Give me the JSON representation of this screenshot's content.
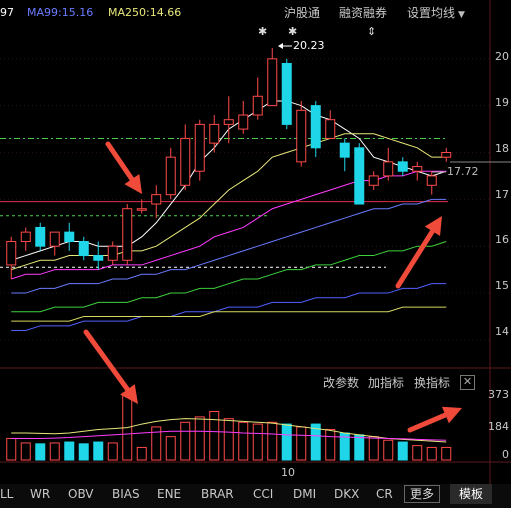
{
  "top_bar": {
    "ma_items": [
      {
        "label": "97",
        "color": "#ffffff"
      },
      {
        "label": "MA99:15.16",
        "color": "#6a7bff"
      },
      {
        "label": "MA250:14.66",
        "color": "#e8e87a"
      }
    ],
    "menu": [
      {
        "label": "沪股通"
      },
      {
        "label": "融资融券"
      },
      {
        "label": "设置均线",
        "dropdown": true
      }
    ]
  },
  "price_axis": {
    "ticks": [
      "20",
      "19",
      "18",
      "17",
      "16",
      "15",
      "14"
    ]
  },
  "annotations": {
    "high_price": "20.23",
    "last_price": "17.72",
    "marker_star": "✱",
    "marker_arrow": "⇕"
  },
  "indicator_menu": {
    "items": [
      "改参数",
      "加指标",
      "换指标"
    ],
    "close": "✕"
  },
  "volume_axis": {
    "ticks": [
      "373",
      "184",
      "0"
    ]
  },
  "x_axis": {
    "ticks": [
      "10"
    ]
  },
  "bottom_tabs": {
    "items": [
      "LL",
      "WR",
      "OBV",
      "BIAS",
      "ENE",
      "BRAR",
      "CCI",
      "DMI",
      "DKX",
      "CR"
    ],
    "more": "更多",
    "template": "模板"
  },
  "colors": {
    "up": "#ff4a4a",
    "down": "#1ed6e8",
    "ma_white": "#ffffff",
    "ma_yellow": "#e8e87a",
    "ma_magenta": "#ff3cff",
    "ma_blue": "#6a7bff",
    "ma_green": "#3cd23c",
    "dash_green": "#4ad04a",
    "arrow": "#f04a3a",
    "support": "#e0304a"
  },
  "chart_data": {
    "type": "candlestick",
    "ylim": [
      13.4,
      20.7
    ],
    "candles": [
      {
        "o": 15.6,
        "h": 16.2,
        "l": 15.3,
        "c": 16.1
      },
      {
        "o": 16.1,
        "h": 16.4,
        "l": 15.9,
        "c": 16.3
      },
      {
        "o": 16.4,
        "h": 16.5,
        "l": 15.9,
        "c": 16.0
      },
      {
        "o": 16.0,
        "h": 16.3,
        "l": 15.8,
        "c": 16.3
      },
      {
        "o": 16.3,
        "h": 16.5,
        "l": 15.9,
        "c": 16.1
      },
      {
        "o": 16.1,
        "h": 16.2,
        "l": 15.7,
        "c": 15.8
      },
      {
        "o": 15.8,
        "h": 16.1,
        "l": 15.5,
        "c": 15.7
      },
      {
        "o": 15.7,
        "h": 16.1,
        "l": 15.6,
        "c": 16.0
      },
      {
        "o": 15.7,
        "h": 16.9,
        "l": 15.6,
        "c": 16.8
      },
      {
        "o": 16.8,
        "h": 17.0,
        "l": 16.7,
        "c": 16.8
      },
      {
        "o": 16.9,
        "h": 17.3,
        "l": 16.6,
        "c": 17.1
      },
      {
        "o": 17.1,
        "h": 18.1,
        "l": 17.0,
        "c": 17.9
      },
      {
        "o": 17.3,
        "h": 18.6,
        "l": 17.2,
        "c": 18.3
      },
      {
        "o": 17.6,
        "h": 18.7,
        "l": 17.4,
        "c": 18.6
      },
      {
        "o": 18.2,
        "h": 18.8,
        "l": 18.0,
        "c": 18.6
      },
      {
        "o": 18.6,
        "h": 19.2,
        "l": 18.2,
        "c": 18.7
      },
      {
        "o": 18.5,
        "h": 19.1,
        "l": 18.4,
        "c": 18.8
      },
      {
        "o": 18.8,
        "h": 19.6,
        "l": 18.7,
        "c": 19.2
      },
      {
        "o": 19.0,
        "h": 20.23,
        "l": 19.0,
        "c": 20.0
      },
      {
        "o": 19.9,
        "h": 20.0,
        "l": 18.5,
        "c": 18.6
      },
      {
        "o": 17.8,
        "h": 19.1,
        "l": 17.7,
        "c": 18.9
      },
      {
        "o": 19.0,
        "h": 19.1,
        "l": 17.9,
        "c": 18.1
      },
      {
        "o": 18.3,
        "h": 18.9,
        "l": 18.3,
        "c": 18.7
      },
      {
        "o": 18.2,
        "h": 18.3,
        "l": 17.6,
        "c": 17.9
      },
      {
        "o": 18.1,
        "h": 18.2,
        "l": 16.9,
        "c": 16.9
      },
      {
        "o": 17.3,
        "h": 17.6,
        "l": 17.2,
        "c": 17.5
      },
      {
        "o": 17.5,
        "h": 18.1,
        "l": 17.4,
        "c": 17.8
      },
      {
        "o": 17.8,
        "h": 17.9,
        "l": 17.5,
        "c": 17.6
      },
      {
        "o": 17.6,
        "h": 17.8,
        "l": 17.4,
        "c": 17.7
      },
      {
        "o": 17.3,
        "h": 17.6,
        "l": 17.1,
        "c": 17.5
      },
      {
        "o": 17.9,
        "h": 18.1,
        "l": 17.8,
        "c": 18.0
      }
    ],
    "moving_averages": [
      {
        "name": "MA",
        "color": "#ffffff",
        "values": [
          15.7,
          15.8,
          15.9,
          16.0,
          16.1,
          16.1,
          16.0,
          16.0,
          16.0,
          16.2,
          16.5,
          16.9,
          17.3,
          17.8,
          18.1,
          18.5,
          18.7,
          18.9,
          19.1,
          19.1,
          19.0,
          18.8,
          18.7,
          18.5,
          18.3,
          17.9,
          17.8,
          17.7,
          17.6,
          17.5,
          17.6
        ]
      },
      {
        "name": "MA",
        "color": "#e8e87a",
        "values": [
          15.5,
          15.6,
          15.7,
          15.7,
          15.8,
          15.8,
          15.8,
          15.8,
          15.9,
          15.9,
          16.0,
          16.2,
          16.4,
          16.6,
          16.9,
          17.2,
          17.4,
          17.6,
          17.9,
          18.0,
          18.1,
          18.2,
          18.3,
          18.4,
          18.4,
          18.4,
          18.3,
          18.2,
          18.1,
          17.9,
          17.9
        ]
      },
      {
        "name": "MA",
        "color": "#ff3cff",
        "values": [
          15.3,
          15.4,
          15.4,
          15.5,
          15.5,
          15.5,
          15.5,
          15.6,
          15.6,
          15.6,
          15.7,
          15.8,
          15.9,
          16.0,
          16.2,
          16.3,
          16.4,
          16.6,
          16.8,
          16.9,
          17.0,
          17.1,
          17.2,
          17.3,
          17.4,
          17.4,
          17.5,
          17.5,
          17.6,
          17.6,
          17.6
        ]
      },
      {
        "name": "MA",
        "color": "#6a7bff",
        "values": [
          15.0,
          15.0,
          15.1,
          15.1,
          15.2,
          15.2,
          15.2,
          15.3,
          15.3,
          15.4,
          15.4,
          15.5,
          15.5,
          15.6,
          15.7,
          15.8,
          15.9,
          16.0,
          16.1,
          16.2,
          16.3,
          16.4,
          16.5,
          16.6,
          16.7,
          16.8,
          16.8,
          16.9,
          16.9,
          17.0,
          17.0
        ]
      },
      {
        "name": "MA",
        "color": "#3cd23c",
        "values": [
          14.6,
          14.6,
          14.6,
          14.7,
          14.7,
          14.7,
          14.8,
          14.8,
          14.8,
          14.9,
          14.9,
          15.0,
          15.0,
          15.1,
          15.1,
          15.2,
          15.3,
          15.3,
          15.4,
          15.5,
          15.5,
          15.6,
          15.6,
          15.7,
          15.8,
          15.8,
          15.9,
          15.9,
          16.0,
          16.0,
          16.1
        ]
      },
      {
        "name": "MA99",
        "color": "#5060ff",
        "values": [
          14.2,
          14.2,
          14.3,
          14.3,
          14.3,
          14.4,
          14.4,
          14.4,
          14.4,
          14.5,
          14.5,
          14.5,
          14.6,
          14.6,
          14.6,
          14.7,
          14.7,
          14.7,
          14.8,
          14.8,
          14.8,
          14.9,
          14.9,
          14.9,
          15.0,
          15.0,
          15.0,
          15.1,
          15.1,
          15.2,
          15.2
        ]
      },
      {
        "name": "MA250",
        "color": "#d8d860",
        "values": [
          14.4,
          14.4,
          14.4,
          14.4,
          14.4,
          14.5,
          14.5,
          14.5,
          14.5,
          14.5,
          14.5,
          14.5,
          14.5,
          14.5,
          14.6,
          14.6,
          14.6,
          14.6,
          14.6,
          14.6,
          14.6,
          14.6,
          14.6,
          14.6,
          14.6,
          14.6,
          14.6,
          14.7,
          14.7,
          14.7,
          14.7
        ]
      }
    ],
    "hlines": [
      {
        "y": 18.3,
        "style": "dashdot",
        "color": "#4ad04a"
      },
      {
        "y": 16.95,
        "style": "solid",
        "color": "#e0304a"
      },
      {
        "y": 16.65,
        "style": "dash",
        "color": "#4ad04a"
      },
      {
        "y": 15.55,
        "style": "dash",
        "color": "#ffffff"
      }
    ],
    "volume": {
      "ylim": [
        0,
        373
      ],
      "values": [
        120,
        95,
        90,
        95,
        100,
        90,
        100,
        95,
        373,
        70,
        184,
        130,
        210,
        240,
        270,
        230,
        210,
        200,
        210,
        200,
        184,
        200,
        170,
        150,
        140,
        130,
        110,
        100,
        80,
        70,
        70
      ],
      "vol_ma": [
        150,
        150,
        148,
        146,
        150,
        160,
        170,
        175,
        180,
        200,
        215,
        225,
        230,
        228,
        225,
        220,
        215,
        210,
        205,
        195,
        185,
        175,
        165,
        150,
        140,
        130,
        120,
        115,
        110,
        105,
        100
      ],
      "vol_ma2": [
        120,
        120,
        120,
        122,
        125,
        130,
        135,
        140,
        145,
        150,
        155,
        160,
        160,
        160,
        158,
        155,
        150,
        148,
        145,
        140,
        138,
        135,
        130,
        128,
        125,
        122,
        120,
        118,
        115,
        112,
        110
      ]
    }
  }
}
